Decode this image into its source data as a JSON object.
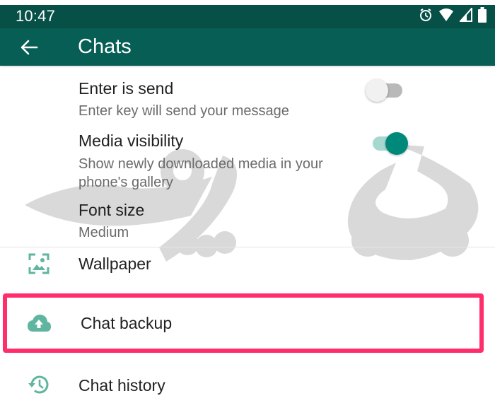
{
  "status_bar": {
    "time": "10:47",
    "icons": [
      "alarm-icon",
      "wifi-icon",
      "signal-icon",
      "battery-icon"
    ]
  },
  "app_bar": {
    "back_icon": "arrow-left-icon",
    "title": "Chats"
  },
  "settings": {
    "enter_is_send": {
      "title": "Enter is send",
      "subtitle": "Enter key will send your message",
      "enabled": false
    },
    "media_visibility": {
      "title": "Media visibility",
      "subtitle_line1": "Show newly downloaded media in your",
      "subtitle_line2": "phone's gallery",
      "enabled": true
    },
    "font_size": {
      "title": "Font size",
      "value": "Medium"
    },
    "items": [
      {
        "label": "Wallpaper",
        "icon": "wallpaper-icon"
      },
      {
        "label": "Chat backup",
        "icon": "cloud-upload-icon",
        "highlighted": true
      },
      {
        "label": "Chat history",
        "icon": "history-icon"
      }
    ]
  },
  "colors": {
    "primary_dark": "#075047",
    "primary": "#075E54",
    "accent": "#00897B",
    "icon_tint": "#5FB5A0",
    "highlight": "#FF2E6B"
  }
}
